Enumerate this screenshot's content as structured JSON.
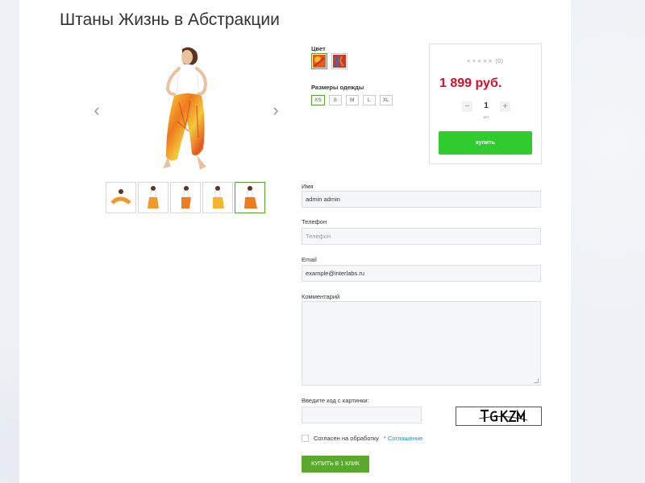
{
  "product": {
    "title": "Штаны Жизнь в Абстракции"
  },
  "gallery": {
    "prev_icon": "chevron-left-icon",
    "next_icon": "chevron-right-icon",
    "thumb_count": 5,
    "active_thumb_index": 4
  },
  "options": {
    "color_label": "Цвет",
    "color_swatches": [
      "orange-red-pattern",
      "red-blue-pattern"
    ],
    "size_label": "Размеры одежды",
    "sizes": [
      "XS",
      "S",
      "M",
      "L",
      "XL"
    ],
    "active_size": "XS"
  },
  "buy_box": {
    "rating_stars": "★★★★★",
    "rating_count": "(0)",
    "rating_value": 0,
    "price": "1 899 руб.",
    "qty_minus": "−",
    "qty_value": "1",
    "qty_plus": "+",
    "qty_unit": "шт",
    "buy_label": "купить"
  },
  "form": {
    "name_label": "Имя",
    "name_value": "admin admin",
    "phone_label": "Телефон",
    "phone_placeholder": "Телефон",
    "email_label": "Email",
    "email_value": "example@interlabs.ru",
    "comment_label": "Комментарий",
    "captcha_label": "Введите код с картинки:",
    "captcha_text": "TGKZM",
    "consent_text": "Согласен на обработку",
    "consent_required": "*",
    "consent_link": "Соглашение",
    "submit_label": "КУПИТЬ В 1 КЛИК"
  },
  "colors": {
    "accent_green": "#2fcb2f",
    "submit_green": "#5aa82e",
    "price_red": "#d6102b",
    "link_blue": "#1e8fc6"
  }
}
